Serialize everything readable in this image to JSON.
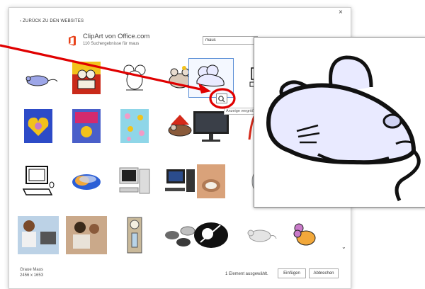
{
  "dialog": {
    "back_link": "ZURÜCK ZU DEN WEBSITES",
    "close_glyph": "×",
    "source_title": "ClipArt von Office.com",
    "source_subtitle": "110 Suchergebnisse für maus",
    "search_value": "maus"
  },
  "results": [
    {
      "name": "mouse-clipart-1",
      "selected": false
    },
    {
      "name": "mouse-clipart-2",
      "selected": false
    },
    {
      "name": "mouse-clipart-3",
      "selected": false
    },
    {
      "name": "mouse-clipart-4",
      "selected": false
    },
    {
      "name": "mouse-clipart-5",
      "selected": true
    },
    {
      "name": "mouse-clipart-6",
      "selected": false
    },
    {
      "name": "mouse-clipart-7",
      "selected": false
    },
    {
      "name": "mouse-clipart-8",
      "selected": false
    },
    {
      "name": "mouse-clipart-9",
      "selected": false
    },
    {
      "name": "mouse-clipart-10",
      "selected": false
    },
    {
      "name": "computer-photo-1",
      "selected": false
    },
    {
      "name": "mouse-clipart-11",
      "selected": false
    },
    {
      "name": "computer-clipart-1",
      "selected": false
    },
    {
      "name": "computer-mouse-photo-1",
      "selected": false
    },
    {
      "name": "computer-photo-2",
      "selected": false
    },
    {
      "name": "computer-photo-3",
      "selected": false
    },
    {
      "name": "hand-mouse-photo-1",
      "selected": false
    },
    {
      "name": "computer-mouse-photo-2",
      "selected": false
    },
    {
      "name": "people-computer-photo-1",
      "selected": false
    },
    {
      "name": "people-computer-photo-2",
      "selected": false
    },
    {
      "name": "clock-clipart-1",
      "selected": false
    },
    {
      "name": "computer-mice-photo-1",
      "selected": false
    },
    {
      "name": "mouse-clipart-12",
      "selected": false
    },
    {
      "name": "mouse-clipart-13",
      "selected": false
    },
    {
      "name": "mouse-clipart-14",
      "selected": false
    }
  ],
  "tooltip": "Anzeige vergrößern",
  "footer": {
    "selected_name": "Graue Maus",
    "selected_size": "2456 x 1653",
    "status": "1 Element ausgewählt.",
    "insert_label": "Einfügen",
    "cancel_label": "Abbrechen"
  },
  "colors": {
    "annotation": "#e00000",
    "selection": "#5b8fd6",
    "office_brand": "#e8421a",
    "mouse_fill": "#e9eaff"
  }
}
